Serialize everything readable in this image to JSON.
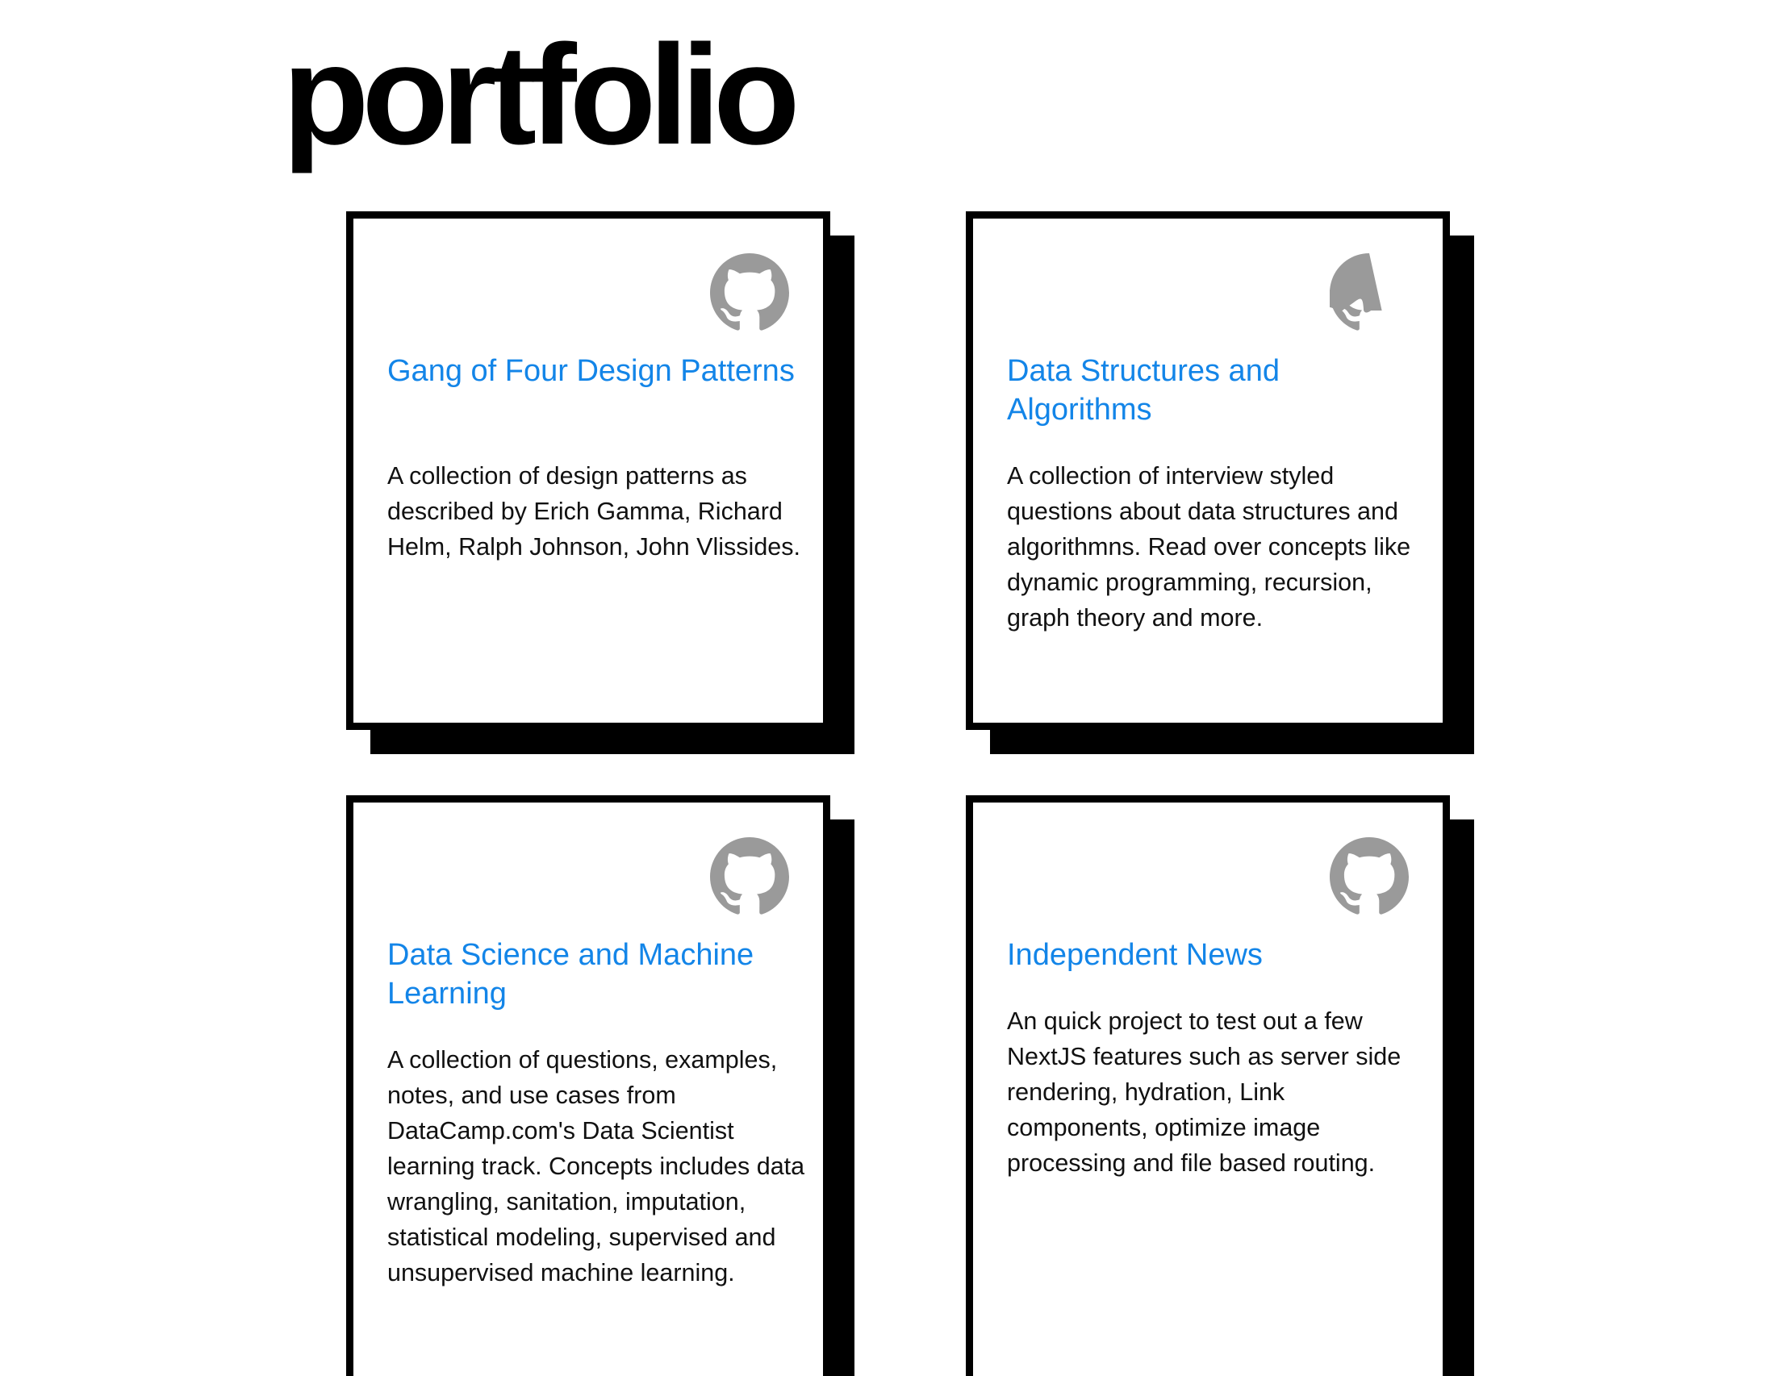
{
  "page": {
    "title": "portfolio"
  },
  "theme": {
    "link_color": "#1385e8",
    "icon_color": "#9a9a9a",
    "border_color": "#000000"
  },
  "projects": [
    {
      "title": "Gang of Four Design Patterns",
      "description": "A collection of design patterns as described by Erich Gamma, Richard Helm, Ralph Johnson, John Vlissides.",
      "icon": "github-icon"
    },
    {
      "title": "Data Structures and Algorithms",
      "description": "A collection of interview styled questions about data structures and algorithmns. Read over concepts like dynamic programming, recursion, graph theory and more.",
      "icon": "github-icon"
    },
    {
      "title": "Data Science and Machine Learning",
      "description": "A collection of questions, examples, notes, and use cases from DataCamp.com's Data Scientist learning track. Concepts includes data wrangling, sanitation, imputation, statistical modeling, supervised and unsupervised machine learning.",
      "icon": "github-icon"
    },
    {
      "title": "Independent News",
      "description": "An quick project to test out a few NextJS features such as server side rendering, hydration, Link components, optimize image processing and file based routing.",
      "icon": "github-icon"
    }
  ]
}
